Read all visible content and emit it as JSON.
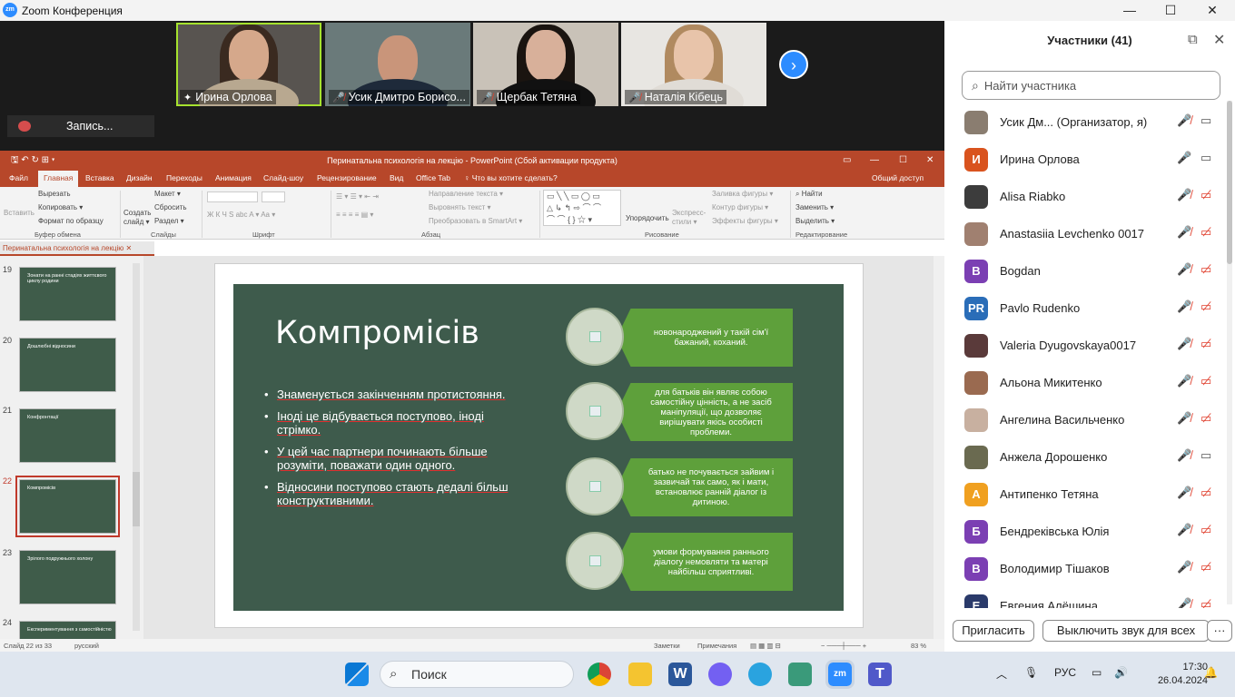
{
  "window": {
    "title": "Zoom Конференция",
    "logo": "zm",
    "minimize": "—",
    "maximize": "☐",
    "close": "✕"
  },
  "videos": [
    {
      "name": "Ирина Орлова",
      "muted": false
    },
    {
      "name": "Усик Дмитро Борисо...",
      "muted": true
    },
    {
      "name": "Щербак Тетяна",
      "muted": true
    },
    {
      "name": "Наталія Кібець",
      "muted": true
    }
  ],
  "recording": {
    "label": "Запись..."
  },
  "ppt": {
    "title": "Перинатальна психологія на лекцію - PowerPoint (Сбой активации продукта)",
    "tabs": [
      "Файл",
      "Главная",
      "Вставка",
      "Дизайн",
      "Переходы",
      "Анимация",
      "Слайд-шоу",
      "Рецензирование",
      "Вид",
      "Office Tab",
      "♀ Что вы хотите сделать?"
    ],
    "share": "Общий доступ",
    "ribbon": {
      "paste": "Вставить",
      "cut": "Вырезать",
      "copy": "Копировать ▾",
      "format": "Формат по образцу",
      "create_slide": "Создать слайд ▾",
      "layout": "Макет ▾",
      "reset": "Сбросить",
      "section": "Раздел ▾",
      "text_dir": "Направление текста ▾",
      "align_text": "Выровнять текст ▾",
      "smartart": "Преобразовать в SmartArt ▾",
      "arrange": "Упорядочить",
      "quick_styles": "Экспресс-стили ▾",
      "fill": "Заливка фигуры ▾",
      "outline": "Контур фигуры ▾",
      "effects": "Эффекты фигуры ▾",
      "find": "Найти",
      "replace": "Заменить ▾",
      "select": "Выделить ▾",
      "groups": [
        "Буфер обмена",
        "Слайды",
        "Шрифт",
        "Абзац",
        "Рисование",
        "Редактирование"
      ]
    },
    "doc_tab": "Перинатальна психологія на лекцію",
    "thumbs": [
      {
        "num": "19",
        "title": "Зонати на ранні стадіях життєвого циклу родини"
      },
      {
        "num": "20",
        "title": "Дошлюбні відносини"
      },
      {
        "num": "21",
        "title": "Конфронтації"
      },
      {
        "num": "22",
        "title": "Компромісів"
      },
      {
        "num": "23",
        "title": "Зрілого подружнього холону"
      },
      {
        "num": "24",
        "title": "Експериментування з самостійністю"
      }
    ],
    "slide": {
      "title": "Компромісів",
      "bullets": [
        "Знаменується закінченням протистояння.",
        "Іноді це відбувається поступово, іноді стрімко.",
        "У цей час партнери починають більше розуміти, поважати один одного.",
        "Відносини поступово стають дедалі більш конструктивними."
      ],
      "boxes": [
        "новонароджений у такій сім'ї бажаний, коханий.",
        "для батьків він являє собою самостійну цінність, а не засіб маніпуляції, що дозволяє вирішувати якісь особисті проблеми.",
        "батько не почувається зайвим і зазвичай так само, як і мати, встановлює ранній діалог із дитиною.",
        "умови формування раннього діалогу немовляти та матері найбільш сприятливі."
      ]
    },
    "status": {
      "slide": "Слайд 22 из 33",
      "lang": "русский",
      "notes": "Заметки",
      "comments": "Примечания",
      "zoom": "83 %"
    }
  },
  "participants": {
    "header": "Участники (41)",
    "search_placeholder": "Найти участника",
    "list": [
      {
        "name": "Усик Дм...  (Организатор, я)",
        "initials": "",
        "color": "#8a7d70",
        "mic": "muted",
        "cam": "on"
      },
      {
        "name": "Ирина Орлова",
        "initials": "И",
        "color": "#d9531e",
        "mic": "on",
        "cam": "on"
      },
      {
        "name": "Alisa Riabko",
        "initials": "",
        "color": "#3c3c3c",
        "mic": "muted",
        "cam": "off"
      },
      {
        "name": "Anastasiia Levchenko 0017",
        "initials": "",
        "color": "#a08070",
        "mic": "muted",
        "cam": "off"
      },
      {
        "name": "Bogdan",
        "initials": "B",
        "color": "#7b3fb3",
        "mic": "muted",
        "cam": "off"
      },
      {
        "name": "Pavlo Rudenko",
        "initials": "PR",
        "color": "#2a6db8",
        "mic": "muted",
        "cam": "off"
      },
      {
        "name": "Valeria Dyugovskaya0017",
        "initials": "",
        "color": "#5a3a3a",
        "mic": "muted",
        "cam": "off"
      },
      {
        "name": "Альона Микитенко",
        "initials": "",
        "color": "#9a6a50",
        "mic": "muted",
        "cam": "off"
      },
      {
        "name": "Ангелина Васильченко",
        "initials": "",
        "color": "#c8b0a0",
        "mic": "muted",
        "cam": "off"
      },
      {
        "name": "Анжела Дорошенко",
        "initials": "",
        "color": "#6a6a50",
        "mic": "muted",
        "cam": "on"
      },
      {
        "name": "Антипенко Тетяна",
        "initials": "А",
        "color": "#f0a020",
        "mic": "muted",
        "cam": "off"
      },
      {
        "name": "Бендреківська Юлія",
        "initials": "Б",
        "color": "#7b3fb3",
        "mic": "muted",
        "cam": "off"
      },
      {
        "name": "Володимир Тішаков",
        "initials": "В",
        "color": "#7b3fb3",
        "mic": "muted",
        "cam": "off"
      },
      {
        "name": "Евгения Алёшина",
        "initials": "Е",
        "color": "#2a3a6a",
        "mic": "muted",
        "cam": "off"
      }
    ],
    "invite": "Пригласить",
    "mute_all": "Выключить звук для всех",
    "more": "···"
  },
  "taskbar": {
    "search": "Поиск",
    "lang": "РУС",
    "time": "17:30",
    "date": "26.04.2024"
  },
  "icons": {
    "search": "search-icon",
    "start": "windows-start-icon"
  }
}
